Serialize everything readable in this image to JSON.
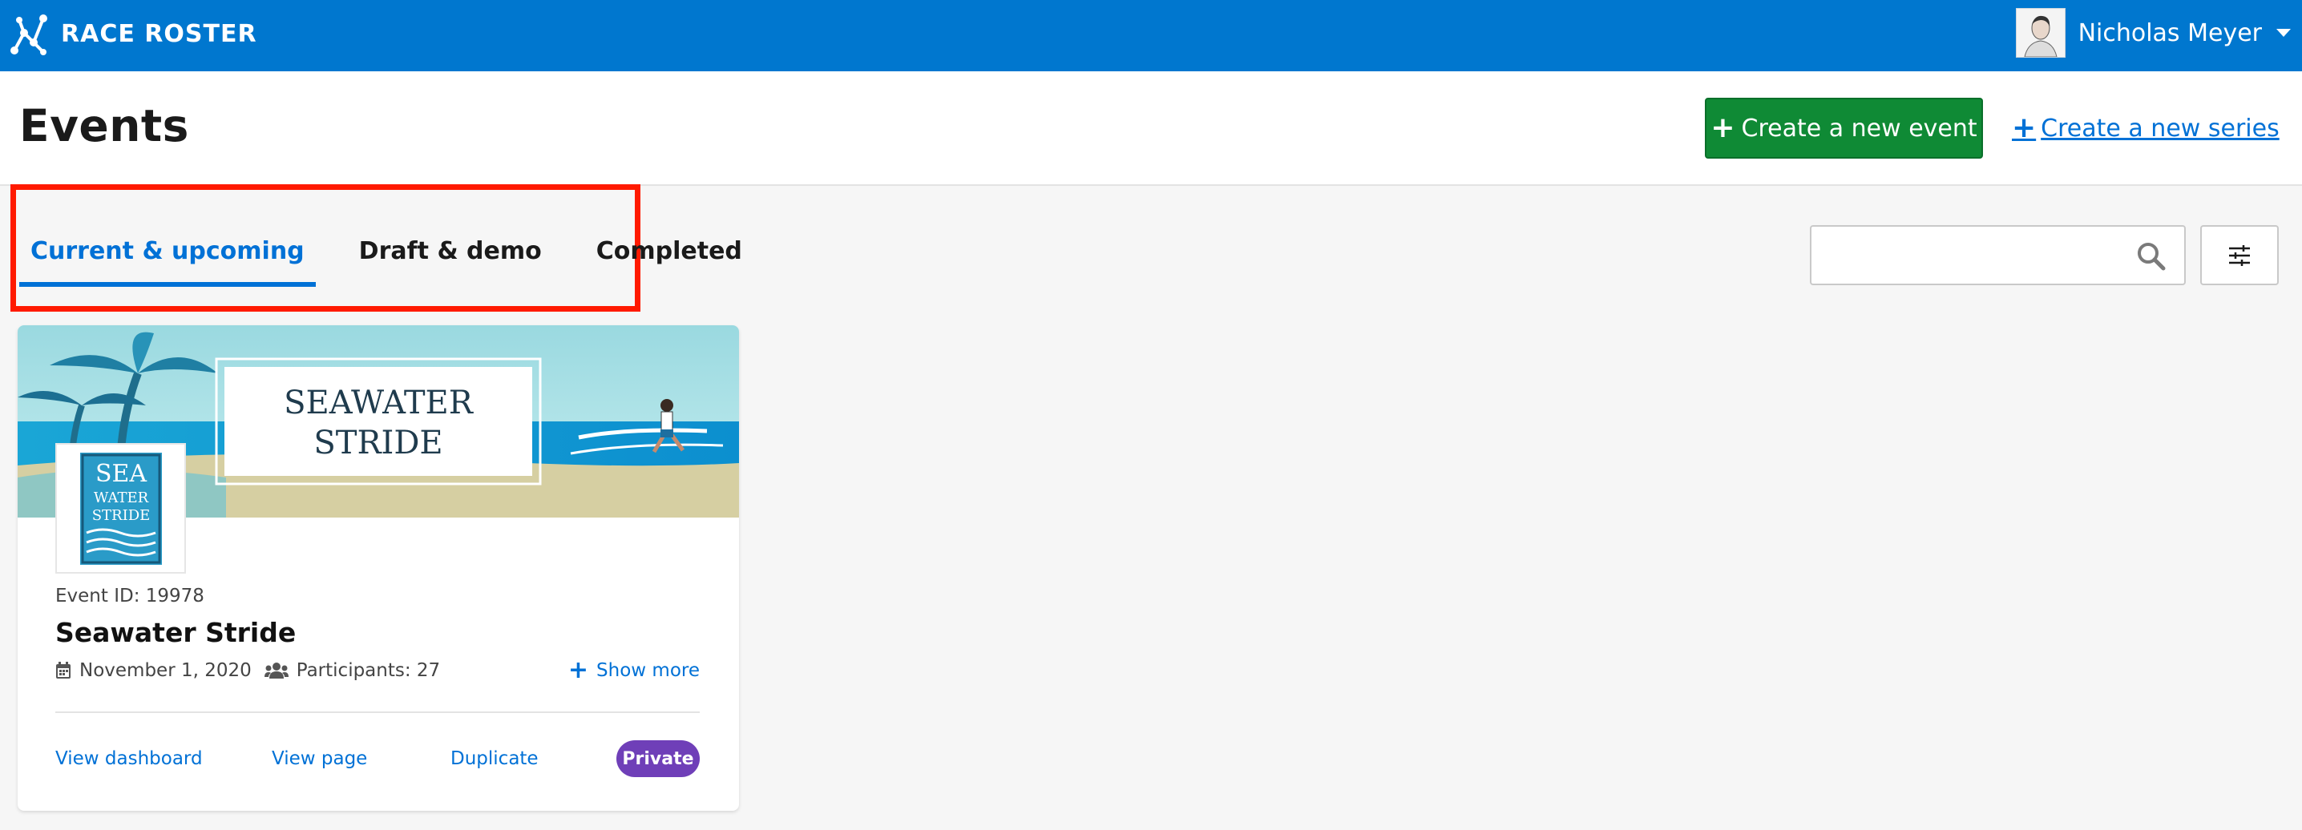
{
  "topbar": {
    "brand": "RACE ROSTER",
    "user_name": "Nicholas Meyer",
    "color": "#0077cf"
  },
  "header": {
    "title": "Events",
    "create_event_label": "Create a new event",
    "create_series_label": "Create a new series"
  },
  "tabs": [
    {
      "label": "Current & upcoming",
      "active": true
    },
    {
      "label": "Draft & demo",
      "active": false
    },
    {
      "label": "Completed",
      "active": false
    }
  ],
  "search": {
    "placeholder": "",
    "icon": "search-icon"
  },
  "filter": {
    "icon": "sliders-icon"
  },
  "event": {
    "banner_title_line1": "SEAWATER",
    "banner_title_line2": "STRIDE",
    "logo_line1": "SEA",
    "logo_line2": "WATER",
    "logo_line3": "STRIDE",
    "id_label": "Event ID: 19978",
    "name": "Seawater Stride",
    "date": "November 1, 2020",
    "participants": "Participants: 27",
    "show_more": "Show more",
    "actions": {
      "view_dashboard": "View dashboard",
      "view_page": "View page",
      "duplicate": "Duplicate"
    },
    "badge": "Private",
    "badge_color": "#6f3fb8"
  },
  "colors": {
    "accent": "#0071d6",
    "create_button": "#0f8a35",
    "highlight_border": "#ff1a00"
  }
}
